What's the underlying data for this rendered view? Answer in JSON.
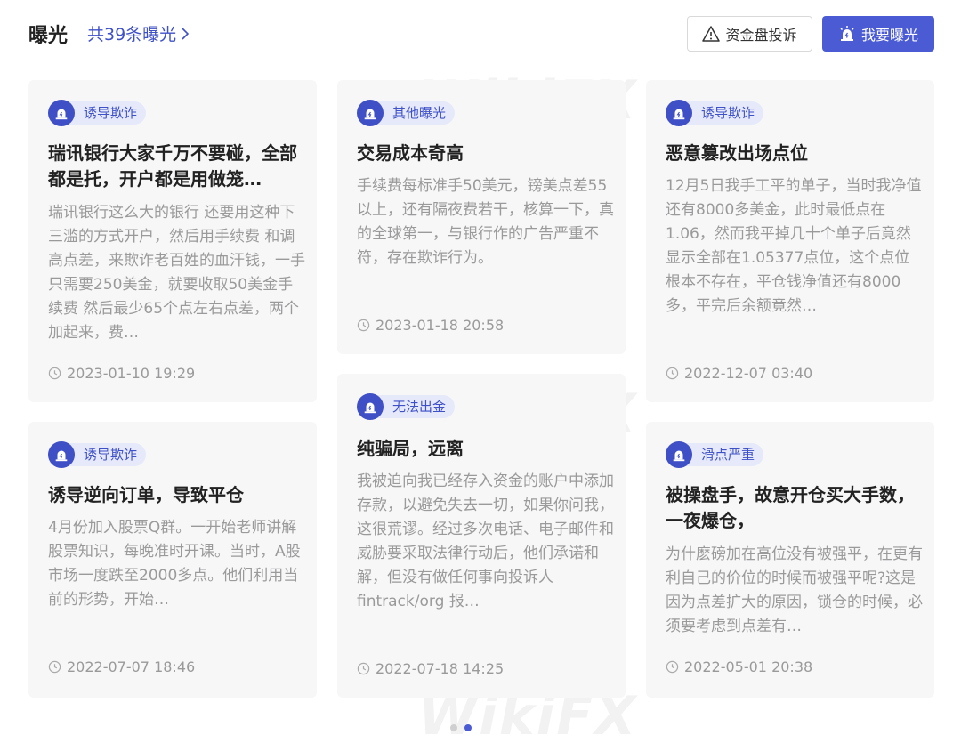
{
  "header": {
    "title": "曝光",
    "count_link": "共39条曝光",
    "complaint_button": "资金盘投诉",
    "expose_button": "我要曝光"
  },
  "cards": [
    {
      "tag": "诱导欺诈",
      "title": "瑞讯银行大家千万不要碰，全部都是托，开户都是用做笼…",
      "body": "瑞讯银行这么大的银行 还要用这种下三滥的方式开户，然后用手续费 和调高点差，来欺诈老百姓的血汗钱，一手只需要250美金，就要收取50美金手续费 然后最少65个点左右点差，两个加起来，费…",
      "time": "2023-01-10 19:29"
    },
    {
      "tag": "其他曝光",
      "title": "交易成本奇高",
      "body": "手续费每标准手50美元，镑美点差55以上，还有隔夜费若干，核算一下，真的全球第一，与银行作的广告严重不符，存在欺诈行为。",
      "time": "2023-01-18 20:58"
    },
    {
      "tag": "诱导欺诈",
      "title": "恶意篡改出场点位",
      "body": "12月5日我手工平的单子，当时我净值还有8000多美金，此时最低点在1.06，然而我平掉几十个单子后竟然显示全部在1.05377点位，这个点位根本不存在，平仓钱净值还有8000多，平完后余额竟然…",
      "time": "2022-12-07 03:40"
    },
    {
      "tag": "诱导欺诈",
      "title": "诱导逆向订单，导致平仓",
      "body": "4月份加入股票Q群。一开始老师讲解股票知识，每晚准时开课。当时，A股市场一度跌至2000多点。他们利用当前的形势，开始…",
      "time": "2022-07-07 18:46"
    },
    {
      "tag": "无法出金",
      "title": "纯骗局，远离",
      "body": "我被迫向我已经存入资金的账户中添加存款，以避免失去一切，如果你问我，这很荒谬。经过多次电话、电子邮件和威胁要采取法律行动后，他们承诺和解，但没有做任何事向投诉人 fintrack/org 报…",
      "time": "2022-07-18 14:25"
    },
    {
      "tag": "滑点严重",
      "title": "被操盘手，故意开仓买大手数，一夜爆仓，",
      "body": "为什麽磅加在高位没有被强平，在更有利自己的价位的时候而被强平呢?这是因为点差扩大的原因，锁仓的时候，必须要考虑到点差有…",
      "time": "2022-05-01 20:38"
    }
  ],
  "watermark": "WikiFX",
  "pagination": {
    "active": 2,
    "total": 2
  }
}
